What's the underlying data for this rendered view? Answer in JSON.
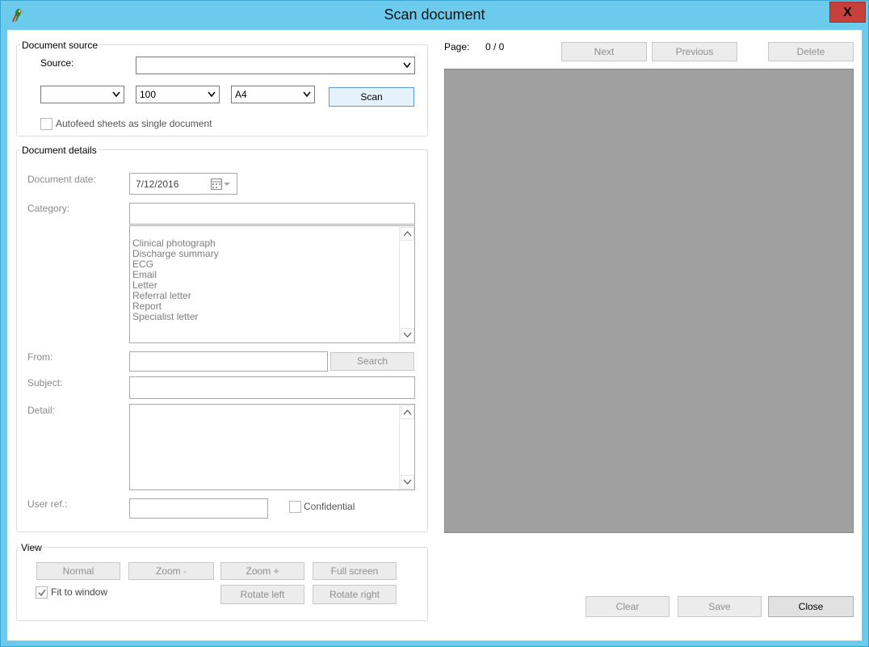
{
  "window": {
    "title": "Scan document",
    "close_glyph": "X"
  },
  "document_source": {
    "group_label": "Document source",
    "source_label": "Source:",
    "source_value": "",
    "combo1_value": "",
    "resolution_value": "100",
    "paper_value": "A4",
    "scan_label": "Scan",
    "autofeed_label": "Autofeed sheets as single document",
    "autofeed_checked": false
  },
  "document_details": {
    "group_label": "Document details",
    "date_label": "Document date:",
    "date_value": "7/12/2016",
    "category_label": "Category:",
    "category_value": "",
    "categories": [
      "Clinical photograph",
      "Discharge summary",
      "ECG",
      "Email",
      "Letter",
      "Referral letter",
      "Report",
      "Specialist letter"
    ],
    "from_label": "From:",
    "search_label": "Search",
    "subject_label": "Subject:",
    "detail_label": "Detail:",
    "user_ref_label": "User ref.:",
    "confidential_label": "Confidential",
    "confidential_checked": false
  },
  "view": {
    "group_label": "View",
    "normal_label": "Normal",
    "zoom_out_label": "Zoom -",
    "zoom_in_label": "Zoom +",
    "full_screen_label": "Full screen",
    "fit_label": "Fit to window",
    "fit_checked": true,
    "rotate_left_label": "Rotate left",
    "rotate_right_label": "Rotate right"
  },
  "page_nav": {
    "page_label": "Page:",
    "page_value": "0 / 0",
    "next_label": "Next",
    "previous_label": "Previous",
    "delete_label": "Delete"
  },
  "footer": {
    "clear_label": "Clear",
    "save_label": "Save",
    "close_label": "Close"
  },
  "colors": {
    "title_bar": "#6ccbec",
    "close_button": "#c7403b",
    "preview_bg": "#a0a0a0"
  }
}
